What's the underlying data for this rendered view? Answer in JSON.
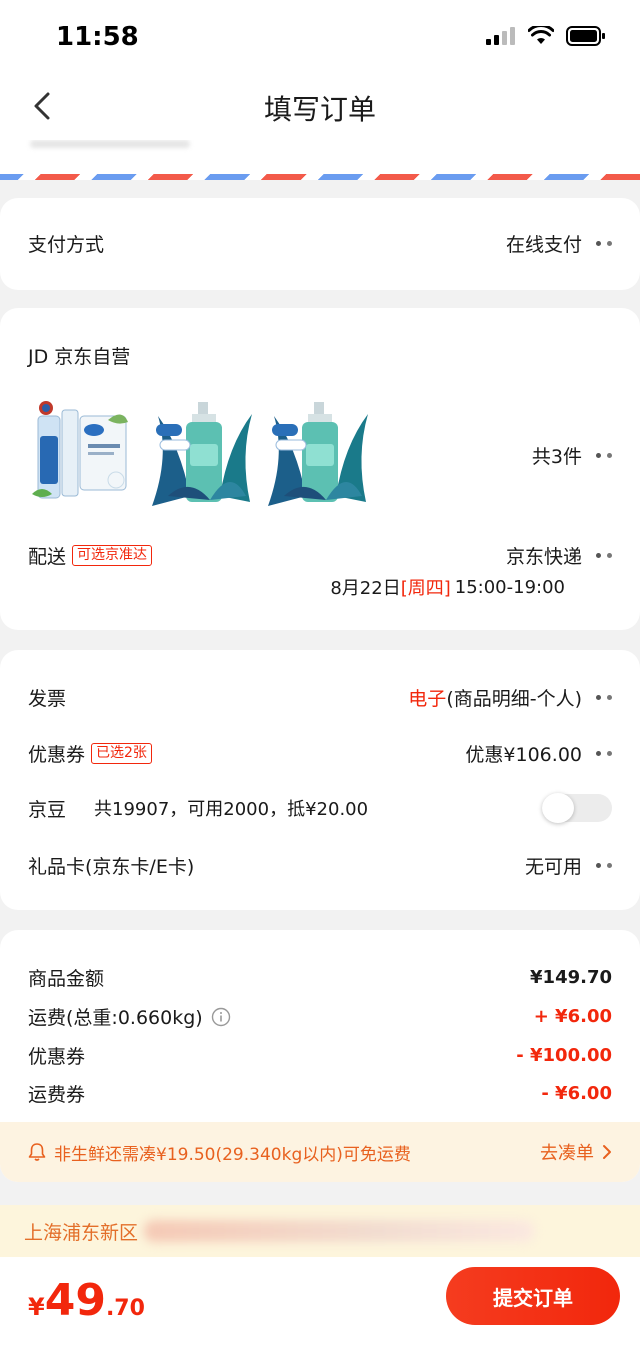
{
  "status_bar": {
    "time": "11:58"
  },
  "nav": {
    "title": "填写订单"
  },
  "payment": {
    "label": "支付方式",
    "value": "在线支付"
  },
  "store": {
    "name": "JD 京东自营",
    "item_count": "共3件",
    "products": [
      "toothpaste-icon",
      "shampoo-bottle-icon",
      "shampoo-bottle-icon"
    ],
    "delivery_label": "配送",
    "delivery_tag": "可选京准达",
    "delivery_value": "京东快递",
    "delivery_date": "8月22日",
    "delivery_weekday": "[周四]",
    "delivery_time": "15:00-19:00"
  },
  "options": {
    "invoice_label": "发票",
    "invoice_type": "电子",
    "invoice_detail": "(商品明细-个人)",
    "coupon_label": "优惠券",
    "coupon_tag": "已选2张",
    "coupon_value": "优惠¥106.00",
    "beans_label": "京豆",
    "beans_desc": "共19907，可用2000，抵¥20.00",
    "giftcard_label": "礼品卡(京东卡/E卡)",
    "giftcard_value": "无可用"
  },
  "summary": {
    "goods_label": "商品金额",
    "goods_value": "¥149.70",
    "shipping_label": "运费(总重:0.660kg)",
    "shipping_value": "+ ¥6.00",
    "coupon_label": "优惠券",
    "coupon_value": "- ¥100.00",
    "shipping_coupon_label": "运费券",
    "shipping_coupon_value": "- ¥6.00"
  },
  "tip": {
    "text": "非生鲜还需凑¥19.50(29.340kg以内)可免运费",
    "link": "去凑单"
  },
  "address": {
    "text": "上海浦东新区"
  },
  "bottom": {
    "currency": "¥",
    "price_int": "49",
    "price_dec": ".70",
    "submit_label": "提交订单"
  },
  "colors": {
    "accent": "#f2270c",
    "tip": "#e8611f"
  }
}
